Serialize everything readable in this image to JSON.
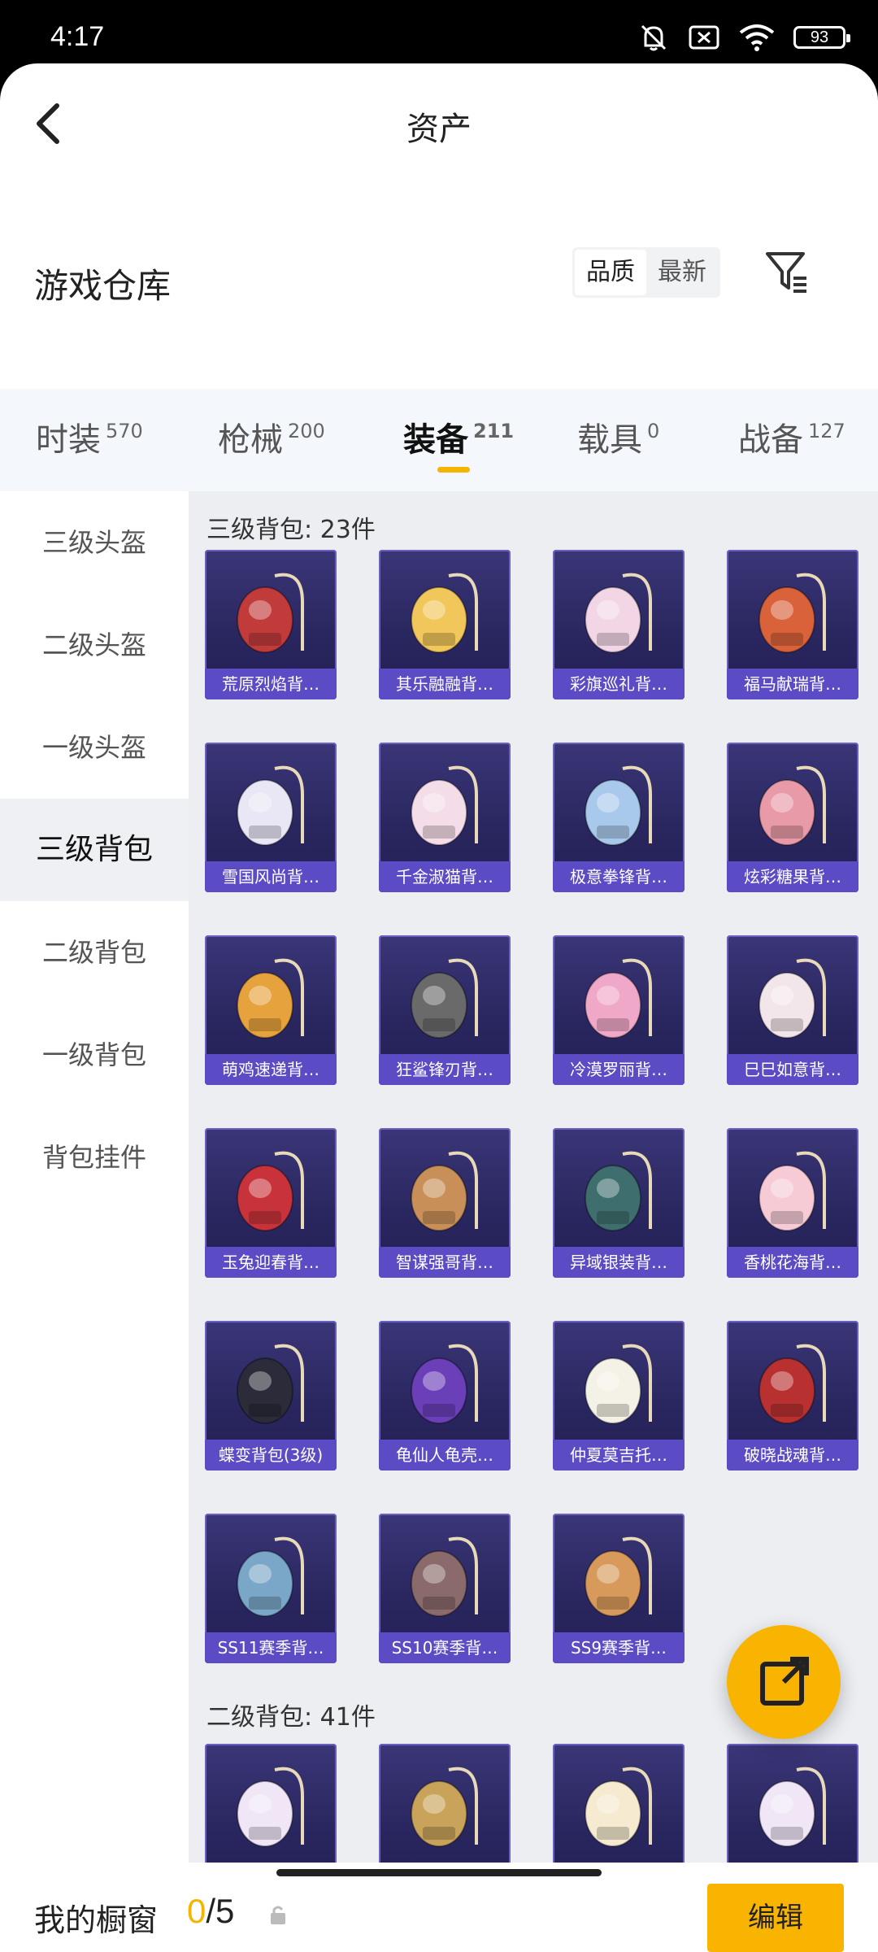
{
  "status": {
    "time": "4:17",
    "battery": "93"
  },
  "header": {
    "title": "资产"
  },
  "section": {
    "title": "游戏仓库",
    "sort_options": [
      "品质",
      "最新"
    ],
    "sort_active": 0
  },
  "tabs": [
    {
      "label": "时装",
      "count": "570"
    },
    {
      "label": "枪械",
      "count": "200"
    },
    {
      "label": "装备",
      "count": "211"
    },
    {
      "label": "载具",
      "count": "0"
    },
    {
      "label": "战备",
      "count": "127"
    }
  ],
  "active_tab": 2,
  "sidebar": [
    {
      "label": "三级头盔"
    },
    {
      "label": "二级头盔"
    },
    {
      "label": "一级头盔"
    },
    {
      "label": "三级背包"
    },
    {
      "label": "二级背包"
    },
    {
      "label": "一级背包"
    },
    {
      "label": "背包挂件"
    }
  ],
  "active_sidebar": 3,
  "groups": [
    {
      "title": "三级背包: 23件",
      "items": [
        {
          "name": "荒原烈焰背…",
          "color": "#c23b3b"
        },
        {
          "name": "其乐融融背…",
          "color": "#f1c65a"
        },
        {
          "name": "彩旗巡礼背…",
          "color": "#f2d6e6"
        },
        {
          "name": "福马献瑞背…",
          "color": "#d9623a"
        },
        {
          "name": "雪国风尚背…",
          "color": "#e9e7f5"
        },
        {
          "name": "千金淑猫背…",
          "color": "#f4dde8"
        },
        {
          "name": "极意拳锋背…",
          "color": "#a9c9ec"
        },
        {
          "name": "炫彩糖果背…",
          "color": "#e89aa8"
        },
        {
          "name": "萌鸡速递背…",
          "color": "#e6a23c"
        },
        {
          "name": "狂鲨锋刃背…",
          "color": "#6a6a6a"
        },
        {
          "name": "冷漠罗丽背…",
          "color": "#f0a8c8"
        },
        {
          "name": "巳巳如意背…",
          "color": "#f3e6ea"
        },
        {
          "name": "玉兔迎春背…",
          "color": "#c8333b"
        },
        {
          "name": "智谋强哥背…",
          "color": "#c89058"
        },
        {
          "name": "异域银装背…",
          "color": "#3f6e6e"
        },
        {
          "name": "香桃花海背…",
          "color": "#f6cbd6"
        },
        {
          "name": "蝶变背包(3级)",
          "color": "#2b2b3a"
        },
        {
          "name": "龟仙人龟壳…",
          "color": "#6a3fb8"
        },
        {
          "name": "仲夏莫吉托…",
          "color": "#f4f1e6"
        },
        {
          "name": "破晓战魂背…",
          "color": "#b83030"
        },
        {
          "name": "SS11赛季背…",
          "color": "#7aa7c7"
        },
        {
          "name": "SS10赛季背…",
          "color": "#8a6a6a"
        },
        {
          "name": "SS9赛季背…",
          "color": "#d89a5a"
        }
      ]
    },
    {
      "title": "二级背包: 41件",
      "items": [
        {
          "name": "",
          "color": "#f0e6f6"
        },
        {
          "name": "",
          "color": "#c9a35a"
        },
        {
          "name": "",
          "color": "#f6ead0"
        },
        {
          "name": "",
          "color": "#f0e6f6"
        }
      ]
    }
  ],
  "bottom": {
    "label": "我的橱窗",
    "count_current": "0",
    "count_total": "/5",
    "edit_label": "编辑"
  }
}
